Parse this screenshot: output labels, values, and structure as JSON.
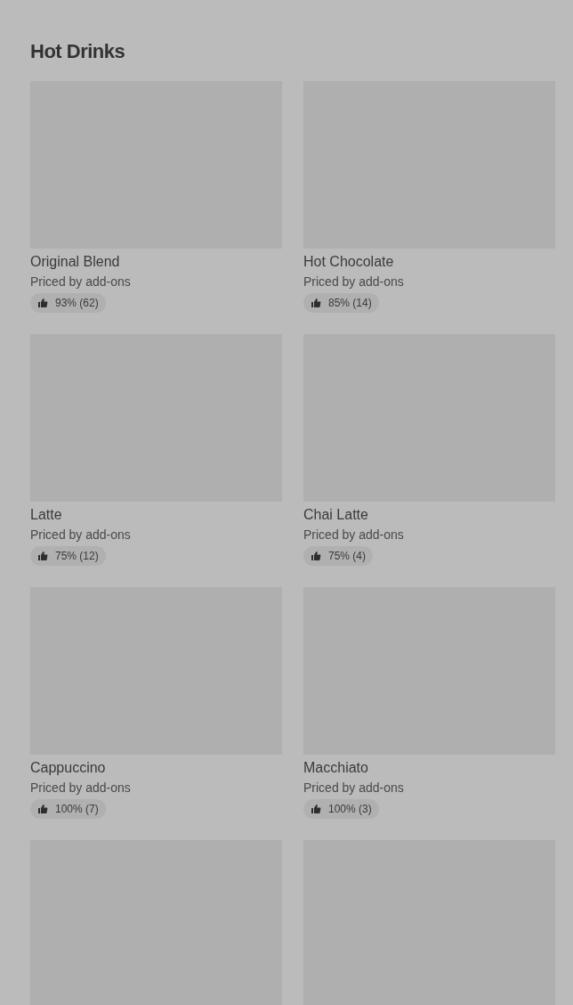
{
  "section": {
    "title": "Hot Drinks"
  },
  "items": [
    {
      "kind": "product",
      "name": "Original Blend",
      "price": "Priced by add-ons",
      "rating": "93% (62)"
    },
    {
      "kind": "product",
      "name": "Hot Chocolate",
      "price": "Priced by add-ons",
      "rating": "85% (14)"
    },
    {
      "kind": "product",
      "name": "Latte",
      "price": "Priced by add-ons",
      "rating": "75% (12)"
    },
    {
      "kind": "product",
      "name": "Chai Latte",
      "price": "Priced by add-ons",
      "rating": "75% (4)"
    },
    {
      "kind": "product",
      "name": "Cappuccino",
      "price": "Priced by add-ons",
      "rating": "100% (7)"
    },
    {
      "kind": "product",
      "name": "Macchiato",
      "price": "Priced by add-ons",
      "rating": "100% (3)"
    },
    {
      "kind": "image"
    },
    {
      "kind": "image"
    }
  ]
}
